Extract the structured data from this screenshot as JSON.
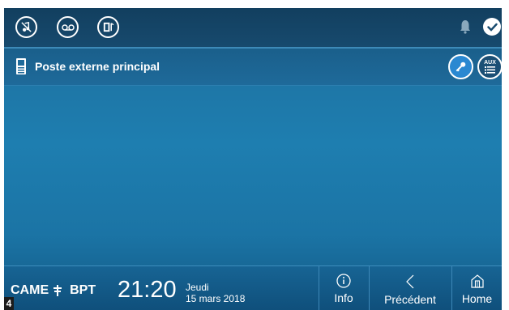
{
  "topbar": {
    "icons": [
      "mute-ringtone-icon",
      "voicemail-icon",
      "door-open-icon",
      "bell-icon",
      "check-icon"
    ]
  },
  "caller": {
    "label": "Poste externe principal",
    "aux_label": "AUX"
  },
  "footer": {
    "brand_left": "CAME",
    "brand_right": "BPT",
    "time": "21:20",
    "day": "Jeudi",
    "date": "15 mars 2018",
    "nav": [
      {
        "label": "Info",
        "icon": "info-icon"
      },
      {
        "label": "Précédent",
        "icon": "chevron-left-icon"
      },
      {
        "label": "Home",
        "icon": "home-icon"
      }
    ]
  },
  "figure_number": "4",
  "colors": {
    "accent": "#2a88d1",
    "background": "#1e7eb0",
    "bar": "#123f5f"
  }
}
